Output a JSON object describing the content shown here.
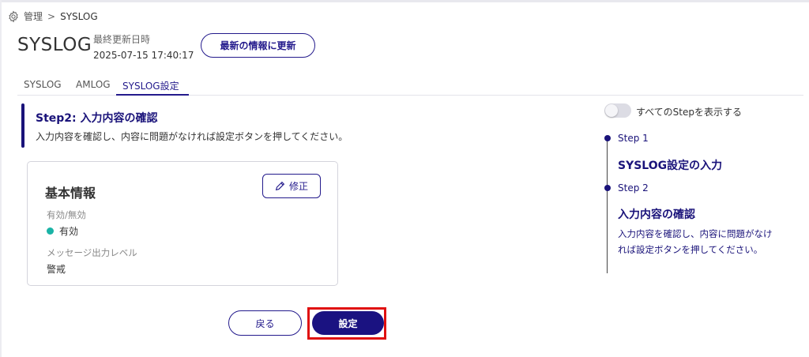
{
  "breadcrumb": {
    "icon": "gear-icon",
    "parent": "管理",
    "separator": ">",
    "current": "SYSLOG"
  },
  "header": {
    "title": "SYSLOG",
    "updated_label": "最終更新日時",
    "updated_value": "2025-07-15 17:40:17",
    "refresh_button": "最新の情報に更新"
  },
  "tabs": [
    {
      "label": "SYSLOG",
      "active": false
    },
    {
      "label": "AMLOG",
      "active": false
    },
    {
      "label": "SYSLOG設定",
      "active": true
    }
  ],
  "step": {
    "title": "Step2: 入力内容の確認",
    "description": "入力内容を確認し、内容に問題がなければ設定ボタンを押してください。"
  },
  "card": {
    "title": "基本情報",
    "edit_button": "修正",
    "edit_icon": "pencil-icon",
    "fields": [
      {
        "label": "有効/無効",
        "value": "有効",
        "status_color": "#1ab3a6"
      },
      {
        "label": "メッセージ出力レベル",
        "value": "警戒"
      }
    ]
  },
  "actions": {
    "back": "戻る",
    "submit": "設定"
  },
  "sidebar": {
    "toggle_label": "すべてのStepを表示する",
    "toggle_on": false,
    "steps": [
      {
        "step": "Step 1",
        "title": "SYSLOG設定の入力"
      },
      {
        "step": "Step 2",
        "title": "入力内容の確認",
        "description": "入力内容を確認し、内容に問題がなければ設定ボタンを押してください。"
      }
    ]
  },
  "colors": {
    "primary": "#231a8c",
    "accent_dark": "#1a137a",
    "status_enabled": "#1ab3a6",
    "highlight": "#e01010"
  }
}
